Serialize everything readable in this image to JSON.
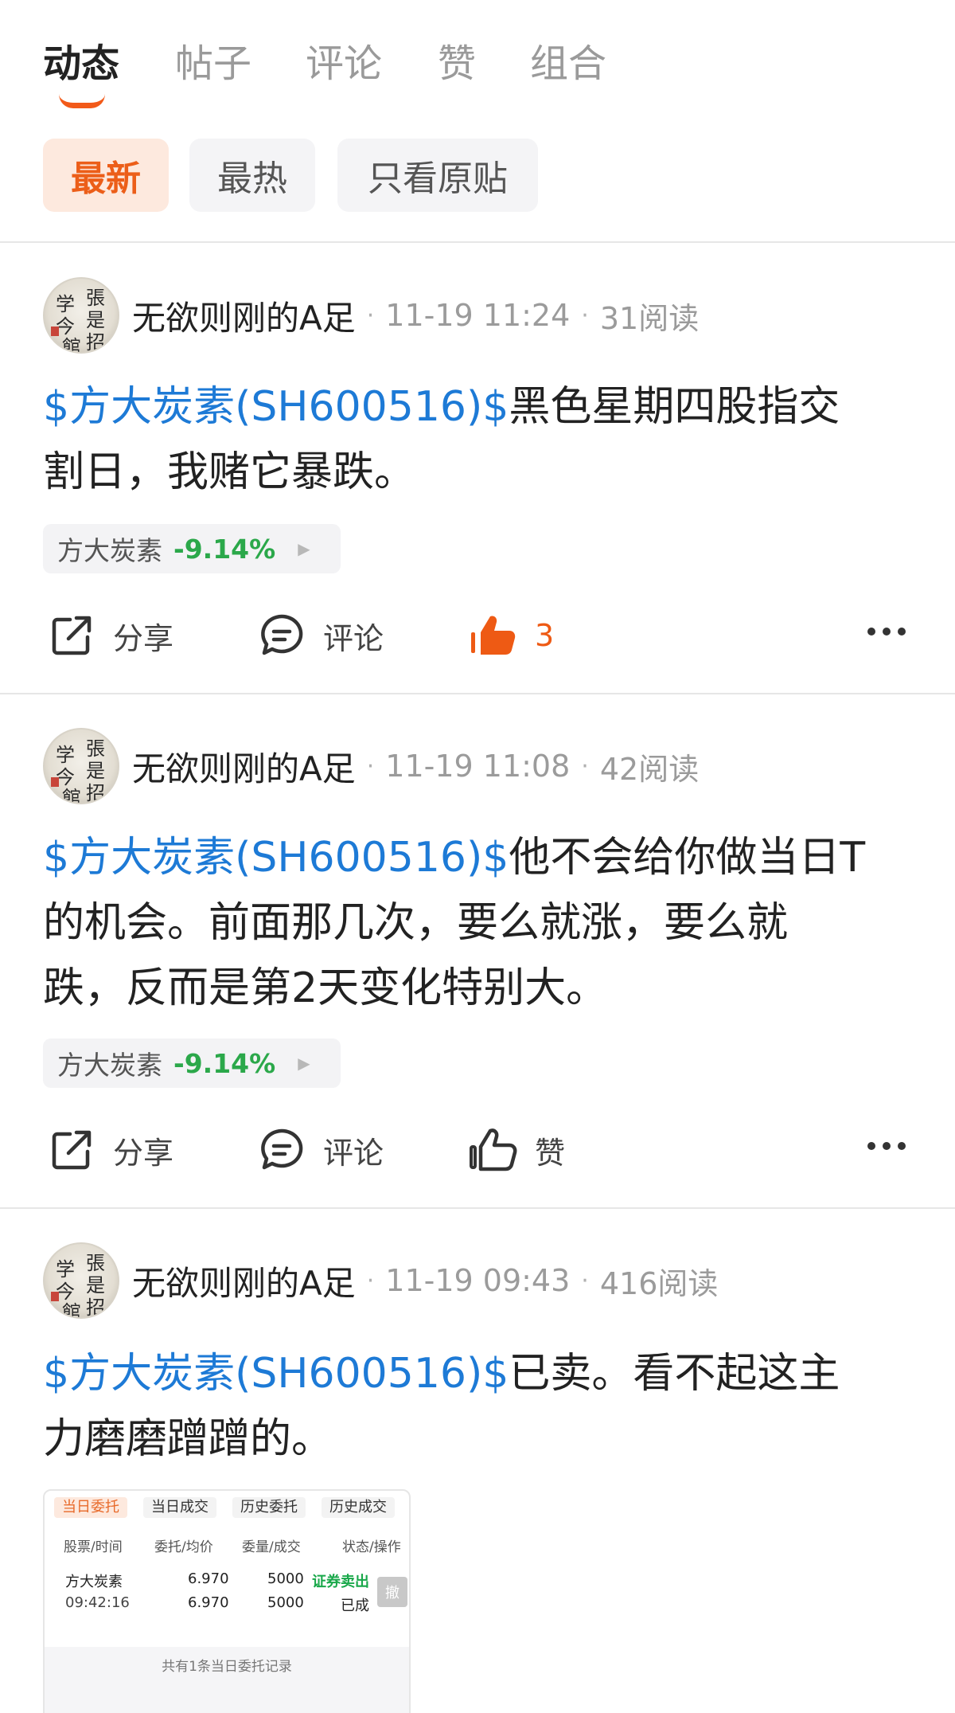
{
  "tabs": [
    "动态",
    "帖子",
    "评论",
    "赞",
    "组合"
  ],
  "filters": [
    "最新",
    "最热",
    "只看原贴"
  ],
  "posts": [
    {
      "author": "无欲则刚的A足",
      "time": "11-19 11:24",
      "reads": "31阅读",
      "stock_link": "$方大炭素(SH600516)$",
      "text_line1": "黑色星期四股指交",
      "text_line2": "割日，我赌它暴跌。",
      "text_line3": "",
      "quote_name": "方大炭素",
      "quote_change": "-9.14%",
      "share": "分享",
      "comment": "评论",
      "like": "3"
    },
    {
      "author": "无欲则刚的A足",
      "time": "11-19 11:08",
      "reads": "42阅读",
      "stock_link": "$方大炭素(SH600516)$",
      "text_line1": "他不会给你做当日T",
      "text_line2": "的机会。前面那几次，要么就涨，要么就",
      "text_line3": "跌，反而是第2天变化特别大。",
      "quote_name": "方大炭素",
      "quote_change": "-9.14%",
      "share": "分享",
      "comment": "评论",
      "like": "赞"
    },
    {
      "author": "无欲则刚的A足",
      "time": "11-19 09:43",
      "reads": "416阅读",
      "stock_link": "$方大炭素(SH600516)$",
      "text_line1": "已卖。看不起这主",
      "text_line2": "力磨磨蹭蹭的。"
    }
  ],
  "screenshot": {
    "tabs": [
      "当日委托",
      "当日成交",
      "历史委托",
      "历史成交"
    ],
    "headers": [
      "股票/时间",
      "委托/均价",
      "委量/成交",
      "状态/操作"
    ],
    "row": {
      "name": "方大炭素",
      "time": "09:42:16",
      "price1": "6.970",
      "price2": "6.970",
      "qty1": "5000",
      "qty2": "5000",
      "status1": "证券卖出",
      "status2": "已成",
      "cancel": "撤"
    },
    "footer": "共有1条当日委托记录"
  },
  "avatar_text": [
    "学",
    "張",
    "今",
    "是",
    "招",
    "館"
  ],
  "colors": {
    "accent": "#f25a19",
    "link": "#1d7ad6",
    "down_green": "#2ba84a"
  }
}
